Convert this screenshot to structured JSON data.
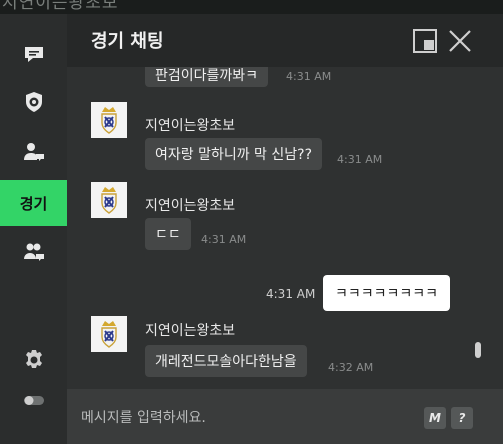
{
  "background": {
    "title": "지연이는왕초보"
  },
  "sidebar": {
    "items": [
      {
        "icon": "chat-bubble-icon"
      },
      {
        "icon": "shield-ball-icon"
      },
      {
        "icon": "user-chat-icon"
      },
      {
        "label": "경기",
        "active": true
      },
      {
        "icon": "group-chat-icon"
      }
    ],
    "settings_icon": "gear-icon",
    "toggle_icon": "toggle-icon"
  },
  "header": {
    "title": "경기 채팅"
  },
  "messages": [
    {
      "type": "partial",
      "text": "판검이다를까봐ㅋ",
      "time": "4:31 AM"
    },
    {
      "type": "other",
      "sender": "지연이는왕초보",
      "text": "여자랑 말하니까 막 신남??",
      "time": "4:31 AM"
    },
    {
      "type": "other",
      "sender": "지연이는왕초보",
      "text": "ㄷㄷ",
      "time": "4:31 AM"
    },
    {
      "type": "mine",
      "text": "ㅋㅋㅋㅋㅋㅋㅋㅋ",
      "time": "4:31 AM"
    },
    {
      "type": "other",
      "sender": "지연이는왕초보",
      "text": "개레전드모솔아다한남을",
      "time": "4:32 AM"
    }
  ],
  "input": {
    "placeholder": "메시지를 입력하세요.",
    "macro_label": "M",
    "help_label": "?"
  },
  "colors": {
    "accent": "#33d467",
    "panel": "#2f3131",
    "bubble": "#454747"
  }
}
